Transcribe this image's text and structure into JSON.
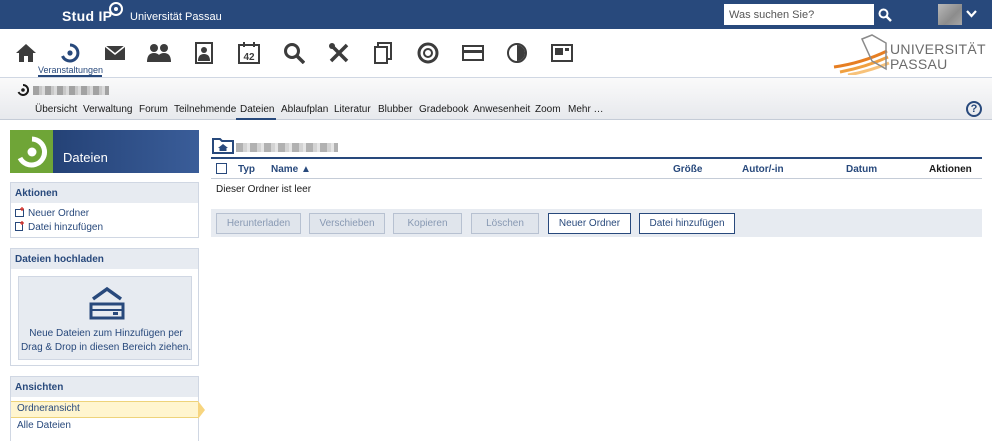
{
  "header": {
    "logo": "Stud IP",
    "university": "Universität Passau",
    "search_placeholder": "Was suchen Sie?",
    "icons": [
      "search-icon",
      "chevron-down-icon"
    ]
  },
  "iconnav": {
    "active_label": "Veranstaltungen",
    "items": [
      "home-icon",
      "courses-icon",
      "messages-icon",
      "community-icon",
      "profile-icon",
      "calendar-icon",
      "search-icon",
      "tools-icon",
      "files-icon",
      "help-center-icon",
      "card-icon",
      "stats-icon",
      "layout-icon"
    ],
    "calendar_number": "42"
  },
  "unilogo": {
    "line1": "UNIVERSITÄT",
    "line2": "PASSAU"
  },
  "course_tabs": {
    "items": [
      "Übersicht",
      "Verwaltung",
      "Forum",
      "Teilnehmende",
      "Dateien",
      "Ablaufplan",
      "Literatur",
      "Blubber",
      "Gradebook",
      "Anwesenheit",
      "Zoom",
      "Mehr …"
    ],
    "active": "Dateien"
  },
  "sidebar": {
    "title": "Dateien",
    "actions": {
      "title": "Aktionen",
      "new_folder": "Neuer Ordner",
      "add_file": "Datei hinzufügen"
    },
    "upload": {
      "title": "Dateien hochladen",
      "hint": "Neue Dateien zum Hinzufügen per Drag & Drop in diesen Bereich ziehen."
    },
    "views": {
      "title": "Ansichten",
      "folder_view": "Ordneransicht",
      "all_files": "Alle Dateien"
    }
  },
  "table": {
    "columns": {
      "type": "Typ",
      "name": "Name",
      "sort_indicator": "▲",
      "size": "Größe",
      "author": "Autor/-in",
      "date": "Datum",
      "actions": "Aktionen"
    },
    "empty_message": "Dieser Ordner ist leer"
  },
  "buttons": {
    "download": "Herunterladen",
    "move": "Verschieben",
    "copy": "Kopieren",
    "delete": "Löschen",
    "new_folder": "Neuer Ordner",
    "add_file": "Datei hinzufügen"
  },
  "help_label": "?",
  "colors": {
    "brand": "#28497c",
    "accent_green": "#6fa537",
    "highlight": "#fff5cf"
  }
}
